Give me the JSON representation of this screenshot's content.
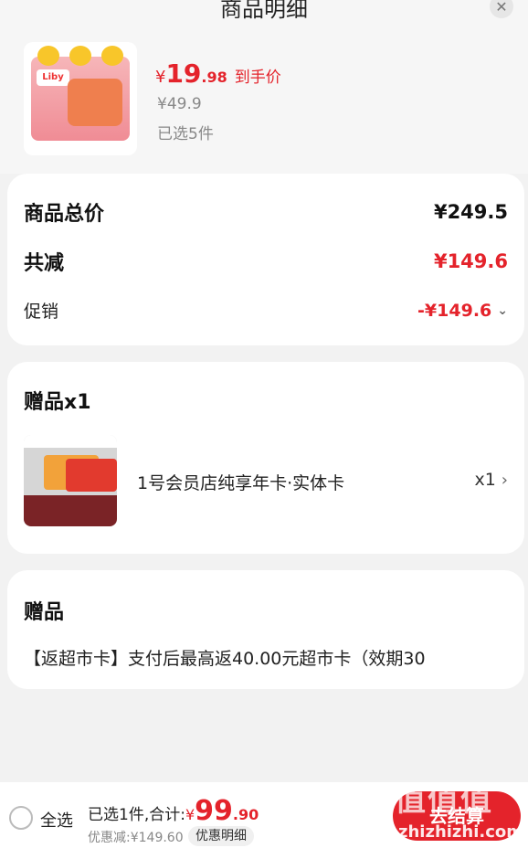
{
  "header": {
    "title": "商品明细",
    "close_icon": "close-icon"
  },
  "product": {
    "price_symbol": "¥",
    "price_int": "19",
    "price_dec": ".98",
    "price_tag": "到手价",
    "original_price": "¥49.9",
    "selected": "已选5件",
    "brand": "Liby"
  },
  "price_summary": {
    "total_label": "商品总价",
    "total_value": "¥249.5",
    "reduce_label": "共减",
    "reduce_value": "¥149.6",
    "promo_label": "促销",
    "promo_value": "-¥149.6"
  },
  "gift_section": {
    "title": "赠品x1",
    "item_name": "1号会员店纯享年卡·实体卡",
    "item_qty": "x1"
  },
  "gift_section2": {
    "title": "赠品",
    "desc": "【返超市卡】支付后最高返40.00元超市卡（效期30"
  },
  "bottom_bar": {
    "select_all": "全选",
    "total_prefix": "已选1件,合计:",
    "total_symbol": "¥",
    "total_int": "99",
    "total_dec": ".90",
    "discount": "优惠减:¥149.60",
    "detail_button": "优惠明细",
    "checkout_button": "去结算"
  },
  "watermark": {
    "logo": "值值值",
    "text": "zhizhizhi.com"
  },
  "colors": {
    "accent": "#e4232b",
    "background": "#f2f2f2"
  }
}
